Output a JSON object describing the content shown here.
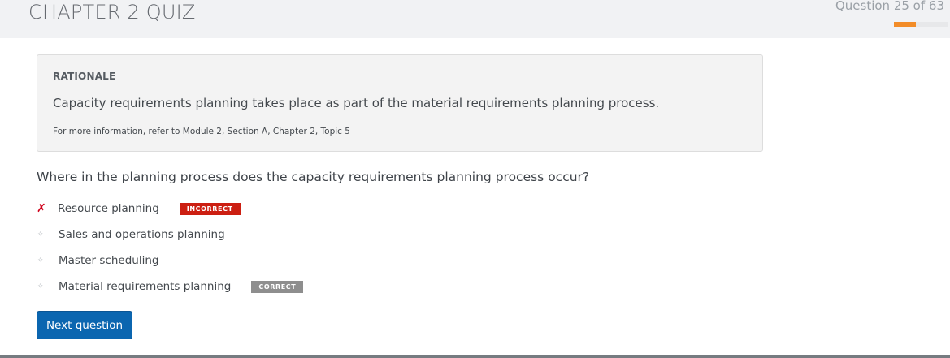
{
  "header": {
    "title": "CHAPTER 2 QUIZ",
    "progress_text": "Question 25 of 63",
    "progress_fraction": 0.397,
    "progress_color": "#f28c28"
  },
  "rationale": {
    "heading": "RATIONALE",
    "text": "Capacity requirements planning takes place as part of the material requirements planning process.",
    "reference": "For more information, refer to Module 2, Section A, Chapter 2, Topic 5"
  },
  "question": {
    "text": "Where in the planning process does the capacity requirements planning process occur?"
  },
  "answers": [
    {
      "label": "Resource planning",
      "marker": "✗",
      "marker_icon": "x-mark-icon",
      "badge": "INCORRECT"
    },
    {
      "label": "Sales and operations planning",
      "marker": "✧",
      "marker_icon": "bullet-icon",
      "badge": ""
    },
    {
      "label": "Master scheduling",
      "marker": "✧",
      "marker_icon": "bullet-icon",
      "badge": ""
    },
    {
      "label": "Material requirements planning",
      "marker": "✧",
      "marker_icon": "bullet-icon",
      "badge": "CORRECT"
    }
  ],
  "actions": {
    "next_label": "Next question"
  }
}
